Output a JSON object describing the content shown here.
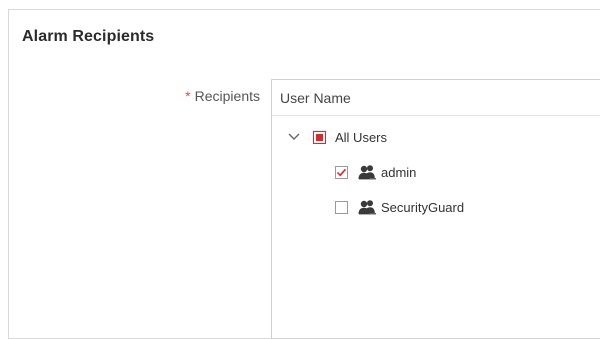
{
  "panel": {
    "title": "Alarm Recipients"
  },
  "recipients": {
    "required_marker": "*",
    "label": "Recipients",
    "column_header": "User Name",
    "tree": {
      "root": {
        "label": "All Users",
        "expanded": true,
        "state": "partial"
      },
      "children": [
        {
          "label": "admin",
          "checked": true,
          "icon": "users-icon"
        },
        {
          "label": "SecurityGuard",
          "checked": false,
          "icon": "users-icon"
        }
      ]
    }
  },
  "colors": {
    "required": "#e04b4b",
    "check": "#e0262a",
    "user_icon": "#3a3a3a"
  }
}
